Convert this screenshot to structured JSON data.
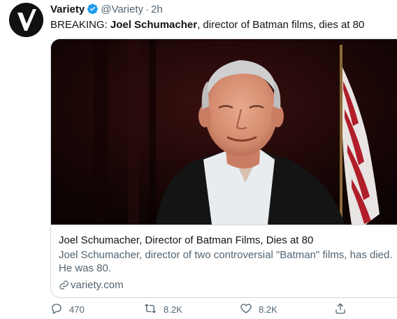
{
  "tweet": {
    "author_name": "Variety",
    "author_handle": "@Variety",
    "separator": "·",
    "time": "2h",
    "text_prefix": "BREAKING: ",
    "text_bold": "Joel Schumacher",
    "text_suffix": ", director of Batman films, dies at 80",
    "avatar_letter": "V"
  },
  "card": {
    "title": "Joel Schumacher, Director of Batman Films, Dies at 80",
    "description": "Joel Schumacher, director of two controversial \"Batman\" films, has died. He was 80.",
    "domain": "variety.com"
  },
  "actions": {
    "replies": "470",
    "retweets": "8.2K",
    "likes": "8.2K"
  },
  "icons": {
    "verified": "verified-badge-icon",
    "reply": "reply-icon",
    "retweet": "retweet-icon",
    "like": "heart-icon",
    "share": "share-icon",
    "link": "link-icon"
  },
  "colors": {
    "verified_blue": "#1d9bf0",
    "secondary_text": "#536471",
    "border": "#cfd9de"
  }
}
